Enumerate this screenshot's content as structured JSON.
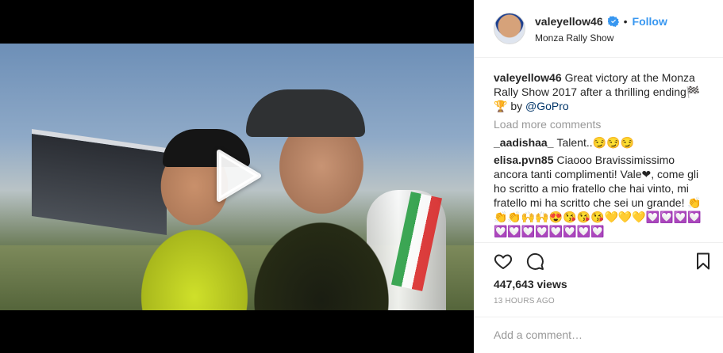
{
  "media": {
    "type": "video",
    "play_icon": "play-icon"
  },
  "header": {
    "username": "valeyellow46",
    "verified_icon": "verified-badge-icon",
    "separator": "•",
    "follow_label": "Follow",
    "location": "Monza Rally Show"
  },
  "caption": {
    "username": "valeyellow46",
    "text": "Great victory at the Monza Rally Show 2017 after a thrilling ending🏁🏆 by ",
    "mention": "@GoPro"
  },
  "load_more_label": "Load more comments",
  "comments": [
    {
      "username": "_aadishaa_",
      "text": "Talent..😏😏😏"
    },
    {
      "username": "elisa.pvn85",
      "text": "Ciaooo Bravissimissimo ancora tanti complimenti! Vale❤, come gli ho scritto a mio fratello che hai vinto, mi fratello mi ha scritto che sei un grande! 👏👏👏🙌🙌😍😘😘😘💛💛💛💟💟💟💟💟💟💟💟💟💟💟💟"
    }
  ],
  "actions": {
    "like_icon": "heart-icon",
    "comment_icon": "comment-icon",
    "save_icon": "bookmark-icon"
  },
  "views_label": "447,643 views",
  "timestamp": "13 HOURS AGO",
  "add_comment": {
    "placeholder": "Add a comment…"
  },
  "colors": {
    "link_blue": "#3897f0",
    "mention_blue": "#003569",
    "muted_gray": "#999999",
    "text": "#262626"
  }
}
